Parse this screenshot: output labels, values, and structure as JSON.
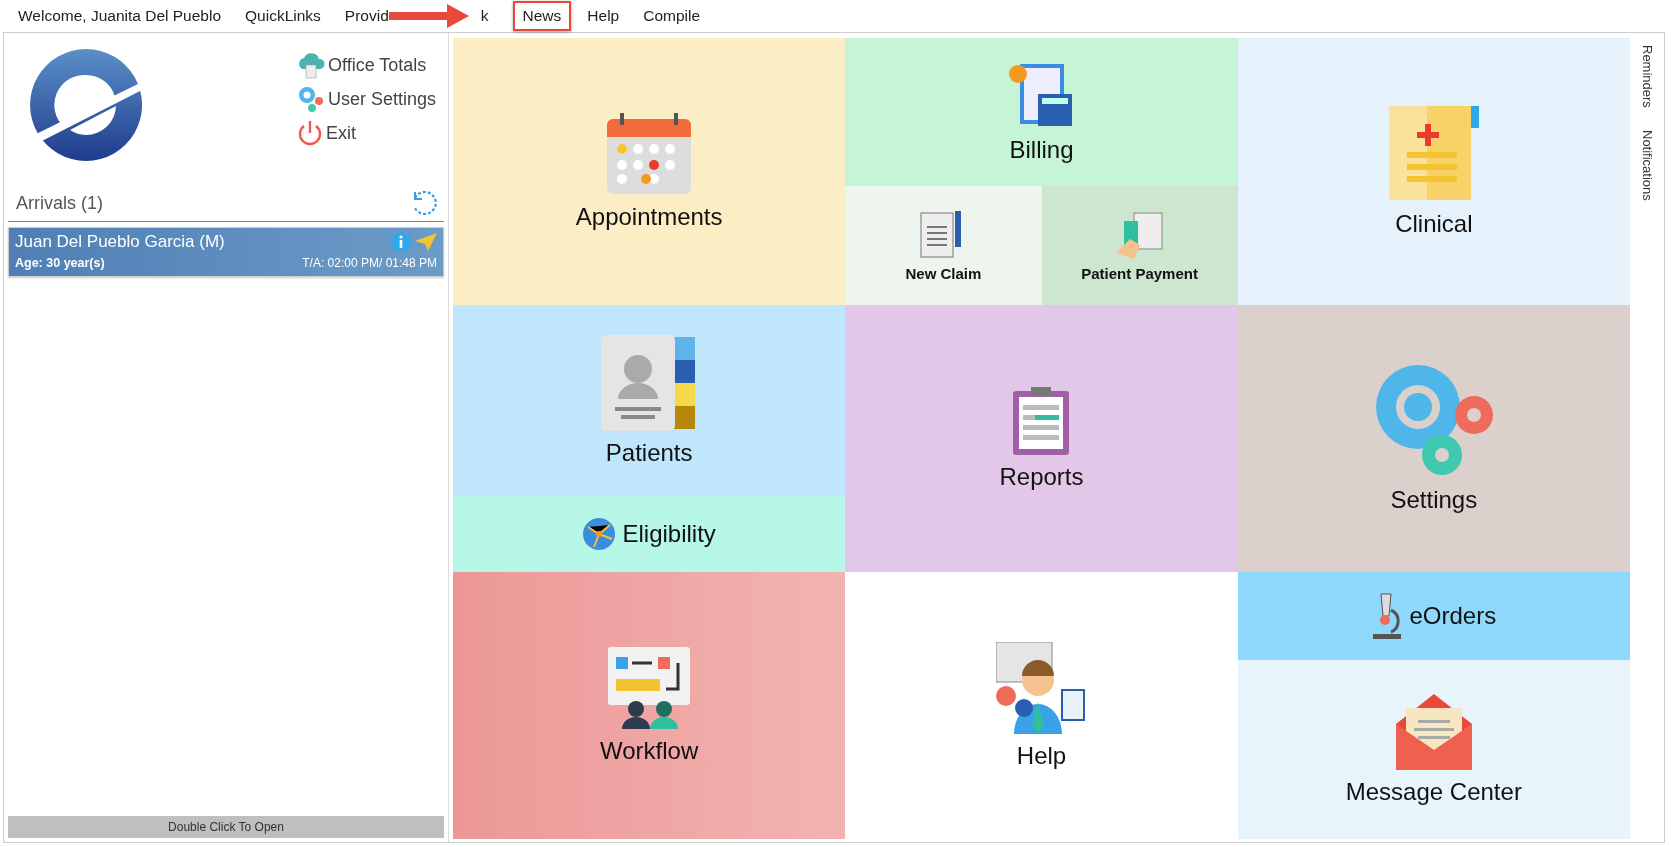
{
  "menu": [
    {
      "label": "Welcome, Juanita Del Pueblo",
      "highlighted": false
    },
    {
      "label": "QuickLinks",
      "highlighted": false
    },
    {
      "label": "Provid",
      "highlighted": false
    },
    {
      "label": "k",
      "highlighted": false
    },
    {
      "label": "News",
      "highlighted": true
    },
    {
      "label": "Help",
      "highlighted": false
    },
    {
      "label": "Compile",
      "highlighted": false
    }
  ],
  "quick_actions": [
    {
      "label": "Office Totals"
    },
    {
      "label": "User Settings"
    },
    {
      "label": "Exit"
    }
  ],
  "arrivals": {
    "title": "Arrivals (1)",
    "items": [
      {
        "name": "Juan Del Pueblo Garcia (M)",
        "age": "Age: 30 year(s)",
        "times": "T/A: 02:00 PM/ 01:48 PM",
        "selected": true
      }
    ],
    "footer": "Double Click To Open"
  },
  "tiles": [
    {
      "label": "Appointments",
      "color": "#fbeec4"
    },
    {
      "label": "Billing",
      "color": "#c6f5d6"
    },
    {
      "label": "New Claim",
      "color": "#eef5ee"
    },
    {
      "label": "Patient Payment",
      "color": "#cde6cf"
    },
    {
      "label": "Clinical",
      "color": "#e6f2fb"
    },
    {
      "label": "Patients",
      "color": "#bfe6fb"
    },
    {
      "label": "Eligibility",
      "color": "#b7f7e8"
    },
    {
      "label": "Reports",
      "color": "#e3c7e8"
    },
    {
      "label": "Settings",
      "color": "#dcd0cd"
    },
    {
      "label": "Workflow",
      "color": "#efa3a2"
    },
    {
      "label": "Help",
      "color": "#ffffff"
    },
    {
      "label": "eOrders",
      "color": "#8dd8fb"
    },
    {
      "label": "Message Center",
      "color": "#e7f4fb"
    }
  ],
  "side_tabs": [
    {
      "label": "Reminders"
    },
    {
      "label": "Notifications"
    }
  ]
}
